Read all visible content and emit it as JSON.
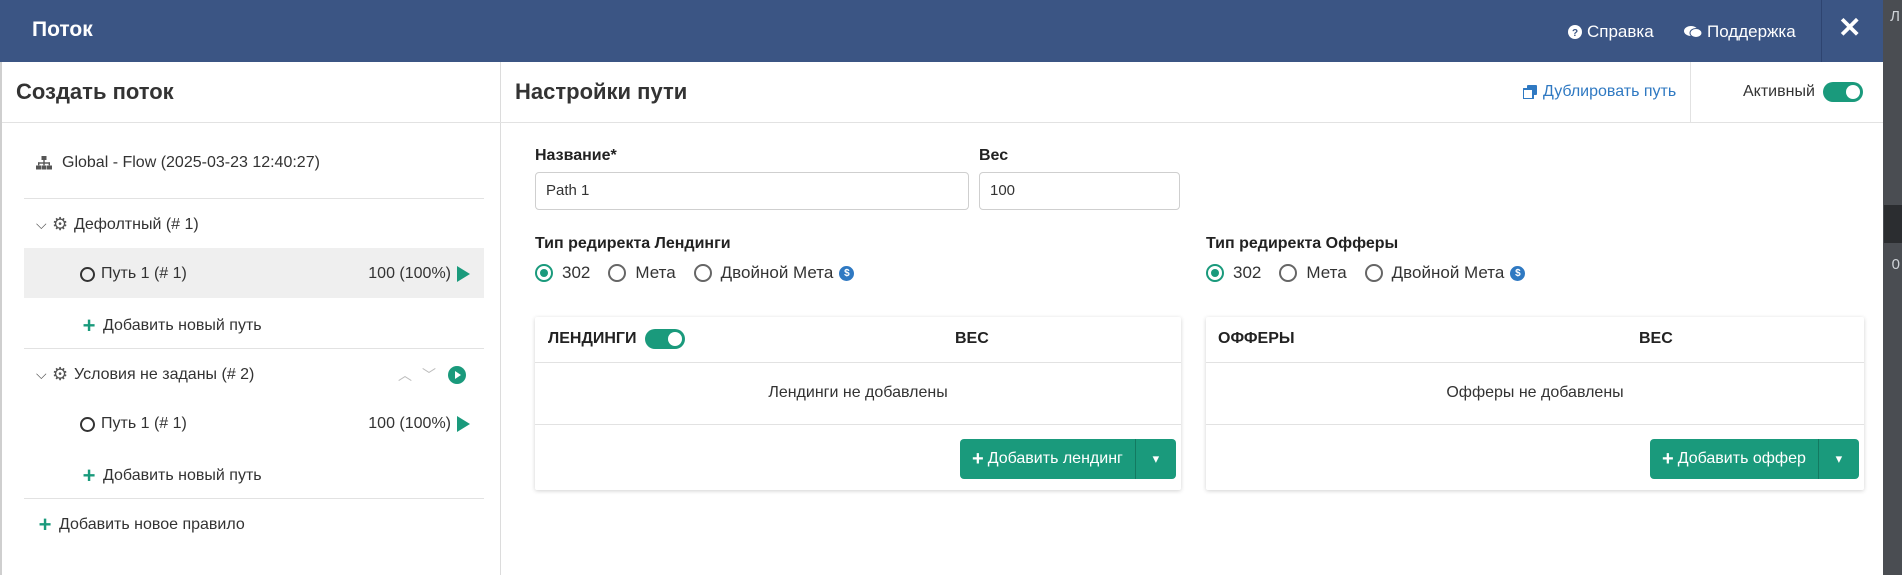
{
  "modal": {
    "title": "Поток",
    "help_label": "Справка",
    "support_label": "Поддержка",
    "close_label": "✕"
  },
  "left": {
    "title": "Создать поток",
    "root_label": "Global - Flow (2025-03-23 12:40:27)",
    "rules": [
      {
        "label": "Дефолтный (# 1)",
        "paths": [
          {
            "label": "Путь 1 (# 1)",
            "weight": "100 (100%)"
          }
        ],
        "add_path_label": "Добавить новый путь"
      },
      {
        "label": "Условия не заданы (# 2)",
        "paths": [
          {
            "label": "Путь 1 (# 1)",
            "weight": "100 (100%)"
          }
        ],
        "add_path_label": "Добавить новый путь"
      }
    ],
    "add_rule_label": "Добавить новое правило"
  },
  "right": {
    "title": "Настройки пути",
    "duplicate_label": "Дублировать путь",
    "active_label": "Активный",
    "active": true,
    "name_label": "Название*",
    "name_value": "Path 1",
    "weight_label": "Вес",
    "weight_value": "100",
    "landing_redirect": {
      "label": "Тип редиректа Лендинги",
      "options": [
        "302",
        "Мета",
        "Двойной Мета"
      ],
      "selected": "302"
    },
    "offer_redirect": {
      "label": "Тип редиректа Офферы",
      "options": [
        "302",
        "Мета",
        "Двойной Мета"
      ],
      "selected": "302"
    },
    "landings": {
      "header": "ЛЕНДИНГИ",
      "weight_header": "ВЕС",
      "enabled": true,
      "empty_text": "Лендинги не добавлены",
      "add_label": "Добавить лендинг"
    },
    "offers": {
      "header": "ОФФЕРЫ",
      "weight_header": "ВЕС",
      "empty_text": "Офферы не добавлены",
      "add_label": "Добавить оффер"
    }
  },
  "backdrop": {
    "text_top": "Л",
    "text_mid": "0"
  },
  "colors": {
    "header_bg": "#3b5584",
    "accent": "#1a9a7c",
    "link": "#2f79c2"
  }
}
